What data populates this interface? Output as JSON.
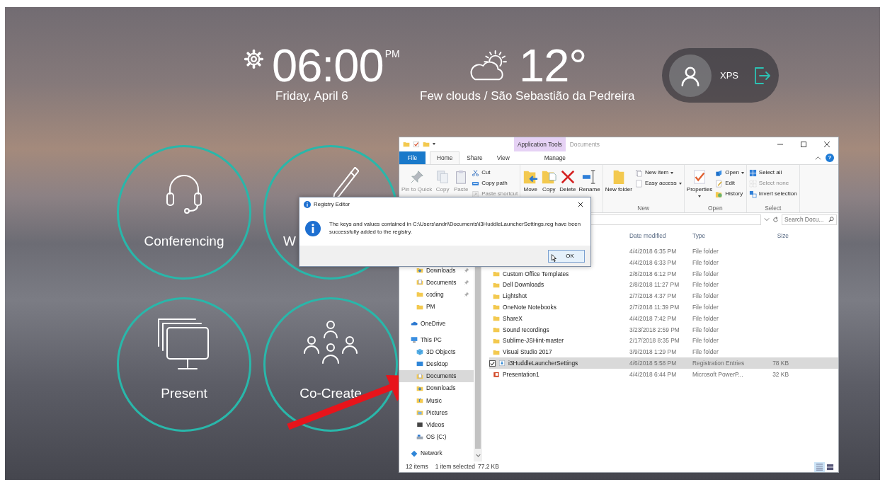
{
  "header": {
    "clock": {
      "time": "06:00",
      "period": "PM",
      "date": "Friday, April 6"
    },
    "weather": {
      "temperature": "12°",
      "description": "Few clouds / São Sebastião da Pedreira"
    },
    "user": {
      "name": "XPS"
    }
  },
  "tiles": [
    {
      "label": "Conferencing"
    },
    {
      "label": "W"
    },
    {
      "label": "Present"
    },
    {
      "label": "Co-Create"
    }
  ],
  "explorer": {
    "title_bar": {
      "context_tab_group": "Application Tools",
      "title": "Documents"
    },
    "tabs": [
      {
        "label": "File",
        "kind": "file",
        "selected": false
      },
      {
        "label": "Home",
        "kind": "tab",
        "selected": true
      },
      {
        "label": "Share",
        "kind": "tab",
        "selected": false
      },
      {
        "label": "View",
        "kind": "tab",
        "selected": false
      },
      {
        "label": "Manage",
        "kind": "contextual",
        "selected": false
      }
    ],
    "help_button": "?",
    "ribbon": {
      "groups": [
        {
          "commands": [
            {
              "label": "Pin to Quick",
              "kind": "large",
              "disabled": true,
              "dropdown": false
            },
            {
              "label": "Copy",
              "kind": "large",
              "disabled": true,
              "dropdown": false
            },
            {
              "label": "Paste",
              "kind": "large",
              "disabled": true,
              "dropdown": false
            },
            {
              "label": "Cut",
              "kind": "small",
              "disabled": false,
              "dropdown": false
            },
            {
              "label": "Copy path",
              "kind": "small",
              "disabled": false,
              "dropdown": false
            },
            {
              "label": "Paste shortcut",
              "kind": "small",
              "disabled": true,
              "dropdown": false
            }
          ]
        },
        {
          "commands": [
            {
              "label": "Move",
              "kind": "large",
              "disabled": false,
              "dropdown": false
            },
            {
              "label": "Copy",
              "kind": "large",
              "disabled": false,
              "dropdown": false
            },
            {
              "label": "Delete",
              "kind": "large",
              "disabled": false,
              "dropdown": false
            },
            {
              "label": "Rename",
              "kind": "large",
              "disabled": false,
              "dropdown": false
            }
          ]
        },
        {
          "label": "New",
          "commands": [
            {
              "label": "New folder",
              "kind": "large",
              "disabled": false,
              "dropdown": false
            },
            {
              "label": "New item",
              "kind": "small",
              "disabled": false,
              "dropdown": true
            },
            {
              "label": "Easy access",
              "kind": "small",
              "disabled": false,
              "dropdown": true
            }
          ]
        },
        {
          "label": "Open",
          "commands": [
            {
              "label": "Properties",
              "kind": "large",
              "disabled": false,
              "dropdown": true
            },
            {
              "label": "Open",
              "kind": "small",
              "disabled": false,
              "dropdown": true
            },
            {
              "label": "Edit",
              "kind": "small",
              "disabled": false,
              "dropdown": false
            },
            {
              "label": "History",
              "kind": "small",
              "disabled": false,
              "dropdown": false
            }
          ]
        },
        {
          "label": "Select",
          "commands": [
            {
              "label": "Select all",
              "kind": "small",
              "disabled": false,
              "dropdown": false
            },
            {
              "label": "Select none",
              "kind": "small",
              "disabled": true,
              "dropdown": false
            },
            {
              "label": "Invert selection",
              "kind": "small",
              "disabled": false,
              "dropdown": false
            }
          ]
        }
      ]
    },
    "search": {
      "placeholder": "Search Docu..."
    },
    "navigation": {
      "quick_access": [
        {
          "label": "Downloads",
          "pinned": true,
          "selected": false
        },
        {
          "label": "Documents",
          "pinned": true,
          "selected": false
        },
        {
          "label": "coding",
          "pinned": true,
          "selected": false
        },
        {
          "label": "PM",
          "pinned": false,
          "selected": false
        }
      ],
      "locations": [
        {
          "label": "OneDrive",
          "selected": false
        },
        {
          "label": "This PC",
          "selected": false,
          "children": [
            {
              "label": "3D Objects",
              "selected": false
            },
            {
              "label": "Desktop",
              "selected": false
            },
            {
              "label": "Documents",
              "selected": true
            },
            {
              "label": "Downloads",
              "selected": false
            },
            {
              "label": "Music",
              "selected": false
            },
            {
              "label": "Pictures",
              "selected": false
            },
            {
              "label": "Videos",
              "selected": false
            },
            {
              "label": "OS (C:)",
              "selected": false
            }
          ]
        },
        {
          "label": "Network",
          "selected": false
        }
      ]
    },
    "file_list": {
      "columns": [
        "Date modified",
        "Type",
        "Size"
      ],
      "rows": [
        {
          "date": "4/4/2018 6:35 PM",
          "type": "File folder",
          "selected": false
        },
        {
          "date": "4/4/2018 6:33 PM",
          "type": "File folder",
          "selected": false
        },
        {
          "name": "Custom Office Templates",
          "date": "2/8/2018 6:12 PM",
          "type": "File folder",
          "kind": "folder",
          "selected": false
        },
        {
          "name": "Dell Downloads",
          "date": "2/8/2018 11:27 PM",
          "type": "File folder",
          "kind": "folder",
          "selected": false
        },
        {
          "name": "Lightshot",
          "date": "2/7/2018 4:37 PM",
          "type": "File folder",
          "kind": "folder",
          "selected": false
        },
        {
          "name": "OneNote Notebooks",
          "date": "2/7/2018 11:39 PM",
          "type": "File folder",
          "kind": "folder",
          "selected": false
        },
        {
          "name": "ShareX",
          "date": "4/4/2018 7:42 PM",
          "type": "File folder",
          "kind": "folder",
          "selected": false
        },
        {
          "name": "Sound recordings",
          "date": "3/23/2018 2:59 PM",
          "type": "File folder",
          "kind": "folder",
          "selected": false
        },
        {
          "name": "Sublime-JSHint-master",
          "date": "2/17/2018 8:35 PM",
          "type": "File folder",
          "kind": "folder",
          "selected": false
        },
        {
          "name": "Visual Studio 2017",
          "date": "3/9/2018 1:29 PM",
          "type": "File folder",
          "kind": "folder",
          "selected": false
        },
        {
          "name": "i3HuddleLauncherSettings",
          "date": "4/6/2018 5:58 PM",
          "type": "Registration Entries",
          "size": "78 KB",
          "kind": "registry",
          "selected": true
        },
        {
          "name": "Presentation1",
          "date": "4/4/2018 6:44 PM",
          "type": "Microsoft PowerP...",
          "size": "32 KB",
          "kind": "presentation",
          "selected": false
        }
      ]
    },
    "status_bar": {
      "item_count": "12 items",
      "selection": "1 item selected",
      "selection_size": "77.2 KB",
      "views": [
        {
          "selected": true
        },
        {
          "selected": false
        }
      ]
    }
  },
  "dialog": {
    "title": "Registry Editor",
    "message": "The keys and values contained in C:\\Users\\andri\\Documents\\i3HuddleLauncherSettings.reg have been successfully added to the registry.",
    "button": "OK"
  }
}
